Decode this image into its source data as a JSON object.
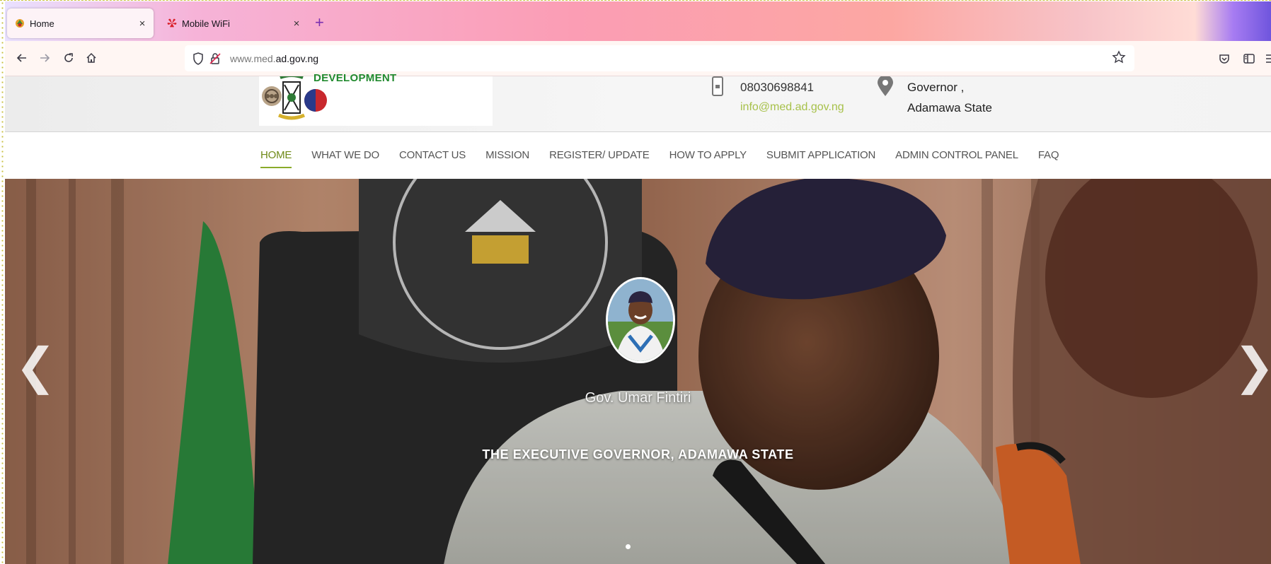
{
  "browser": {
    "tabs": [
      {
        "title": "Home",
        "active": true
      },
      {
        "title": "Mobile WiFi",
        "active": false
      }
    ],
    "close_glyph": "×",
    "new_tab_glyph": "+",
    "url": {
      "prefix": "www.med.",
      "domain": "ad.gov.ng"
    }
  },
  "site": {
    "logo_text": "DEVELOPMENT",
    "contact": {
      "phone": "08030698841",
      "email": "info@med.ad.gov.ng",
      "address_line1": "Governor ,",
      "address_line2": "Adamawa State"
    },
    "menu": [
      {
        "label": "HOME",
        "active": true
      },
      {
        "label": "WHAT WE DO"
      },
      {
        "label": "CONTACT US"
      },
      {
        "label": "MISSION"
      },
      {
        "label": "REGISTER/ UPDATE"
      },
      {
        "label": "HOW TO APPLY"
      },
      {
        "label": "SUBMIT APPLICATION"
      },
      {
        "label": "ADMIN CONTROL PANEL"
      },
      {
        "label": "FAQ"
      }
    ],
    "accent_color": "#8aab2a"
  },
  "hero": {
    "name": "Gov. Umar Fintiri",
    "title": "THE EXECUTIVE GOVERNOR, ADAMAWA STATE",
    "prev_glyph": "❮",
    "next_glyph": "❯"
  },
  "icons": {
    "back": "arrow-left-icon",
    "forward": "arrow-right-icon",
    "reload": "reload-icon",
    "home": "home-icon",
    "shield": "shield-icon",
    "lock": "insecure-lock-icon",
    "bookmark": "star-icon",
    "pocket": "pocket-icon",
    "sidebar": "sidebar-icon",
    "menu": "hamburger-menu-icon",
    "phone": "phone-icon",
    "location": "location-pin-icon"
  }
}
